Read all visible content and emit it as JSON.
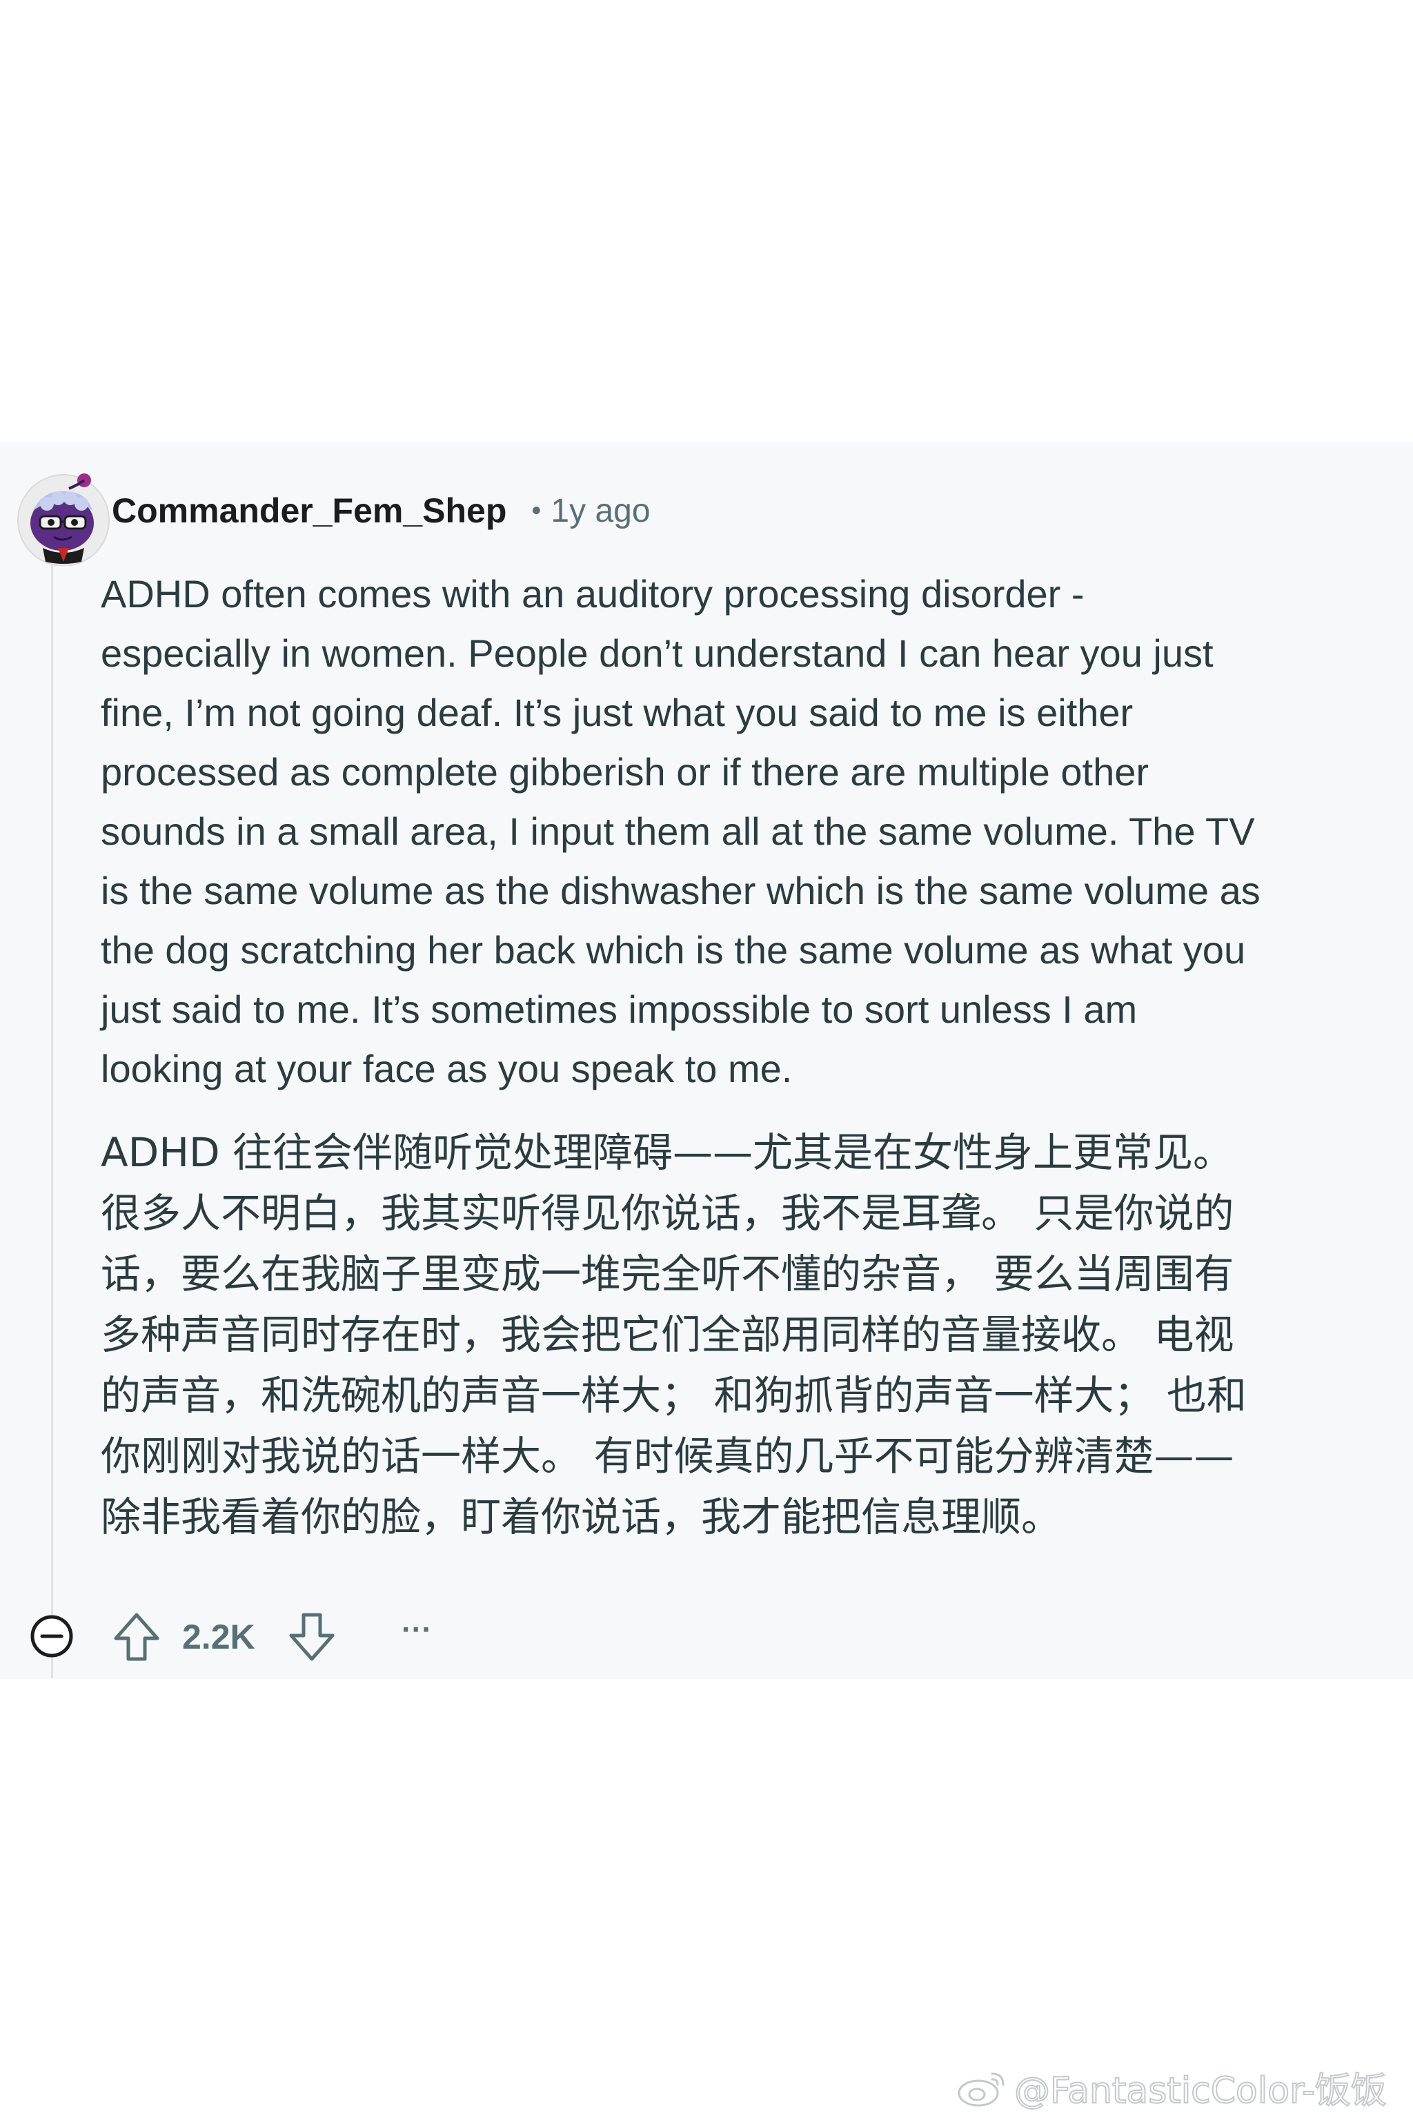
{
  "comment": {
    "username": "Commander_Fem_Shep",
    "separator": "•",
    "timestamp": "1y ago",
    "body_en_lines": [
      "ADHD often comes with an auditory processing disorder -",
      "especially in women. People don’t understand I can hear you just",
      "fine, I’m not going deaf. It’s just what you said to me is either",
      "processed as complete gibberish or if there are multiple other",
      "sounds in a small area, I input them all at the same volume. The TV",
      "is the same volume as the dishwasher which is the same volume as",
      "the dog scratching her back which is the same volume as what you",
      "just said to me. It’s sometimes impossible to sort unless I am",
      "looking at your face as you speak to me."
    ],
    "body_zh_lines": [
      "ADHD 往往会伴随听觉处理障碍——尤其是在女性身上更常见。",
      "很多人不明白，我其实听得见你说话，我不是耳聋。 只是你说的",
      "话，要么在我脑子里变成一堆完全听不懂的杂音， 要么当周围有",
      "多种声音同时存在时，我会把它们全部用同样的音量接收。 电视",
      "的声音，和洗碗机的声音一样大； 和狗抓背的声音一样大； 也和",
      "你刚刚对我说的话一样大。 有时候真的几乎不可能分辨清楚——",
      "除非我看着你的脸，盯着你说话，我才能把信息理顺。"
    ]
  },
  "actions": {
    "collapse_icon": "minus-circle-icon",
    "upvote_icon": "arrow-up-icon",
    "score": "2.2K",
    "downvote_icon": "arrow-down-icon",
    "more_label": "···"
  },
  "watermark": {
    "icon": "weibo-icon",
    "text": "@FantasticColor-饭饭"
  },
  "colors": {
    "card_background": "#f7f8f9",
    "page_background": "#ffffff",
    "text_primary": "#2a3c42",
    "text_muted": "#576f76",
    "avatar_purple": "#5b2e86"
  }
}
